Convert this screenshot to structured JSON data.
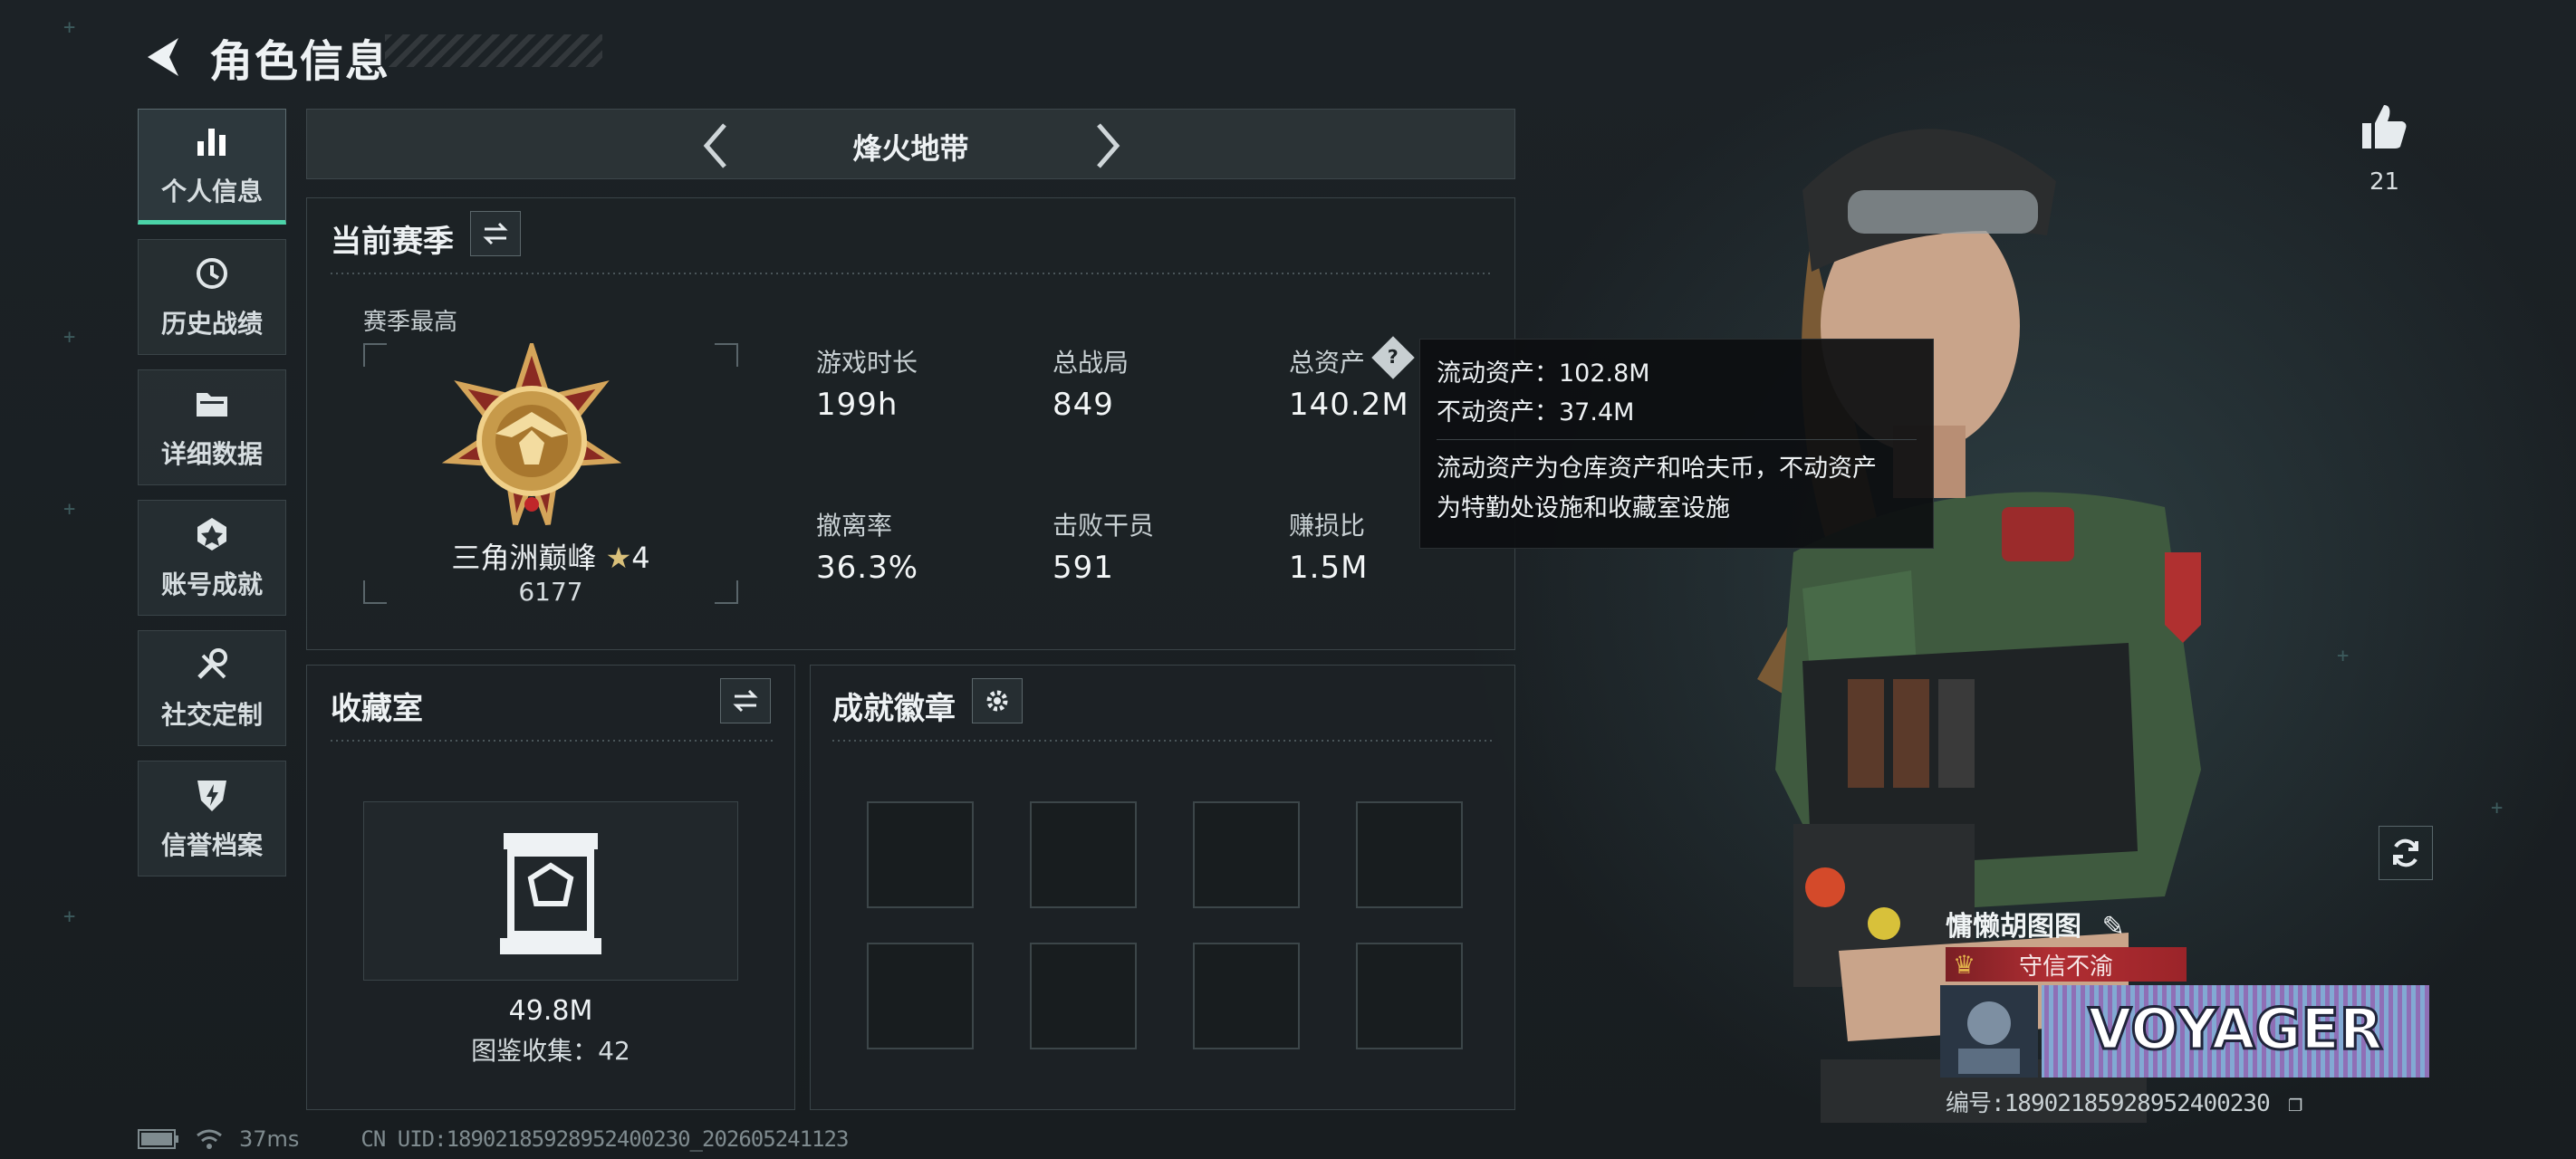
{
  "header": {
    "title": "角色信息"
  },
  "nav": {
    "items": [
      {
        "label": "个人信息",
        "icon": "stats-bar-icon",
        "active": true
      },
      {
        "label": "历史战绩",
        "icon": "history-clock-icon"
      },
      {
        "label": "详细数据",
        "icon": "folder-icon"
      },
      {
        "label": "账号成就",
        "icon": "achievement-icon"
      },
      {
        "label": "社交定制",
        "icon": "tools-icon"
      },
      {
        "label": "信誉档案",
        "icon": "reputation-icon"
      }
    ]
  },
  "mode": {
    "label": "烽火地带"
  },
  "season": {
    "title": "当前赛季",
    "best_label": "赛季最高",
    "rank_name": "三角洲巅峰",
    "rank_stars": "4",
    "rank_score": "6177",
    "stats": [
      {
        "label": "游戏时长",
        "value": "199h"
      },
      {
        "label": "总战局",
        "value": "849"
      },
      {
        "label": "总资产",
        "value": "140.2M"
      },
      {
        "label": "撤离率",
        "value": "36.3%"
      },
      {
        "label": "击败干员",
        "value": "591"
      },
      {
        "label": "赚损比",
        "value": "1.5M"
      }
    ]
  },
  "tooltip": {
    "line1": "流动资产：102.8M",
    "line2": "不动资产：37.4M",
    "desc1": "流动资产为仓库资产和哈夫币，不动资产",
    "desc2": "为特勤处设施和收藏室设施"
  },
  "collection": {
    "title": "收藏室",
    "value": "49.8M",
    "collect_text": "图鉴收集：42"
  },
  "achievements": {
    "title": "成就徽章",
    "slot_count": 8
  },
  "profile": {
    "likes": "21",
    "player_name": "慵懒胡图图",
    "title_badge": "守信不渝",
    "card_text": "VOYAGER",
    "id_line": "编号:18902185928952400230"
  },
  "status_bar": {
    "ping": "37ms",
    "uid": "CN UID:18902185928952400230_202605241123"
  },
  "colors": {
    "accent": "#4bd3a8",
    "badge_red": "#b12e33",
    "panel_bg": "#1c2225"
  }
}
